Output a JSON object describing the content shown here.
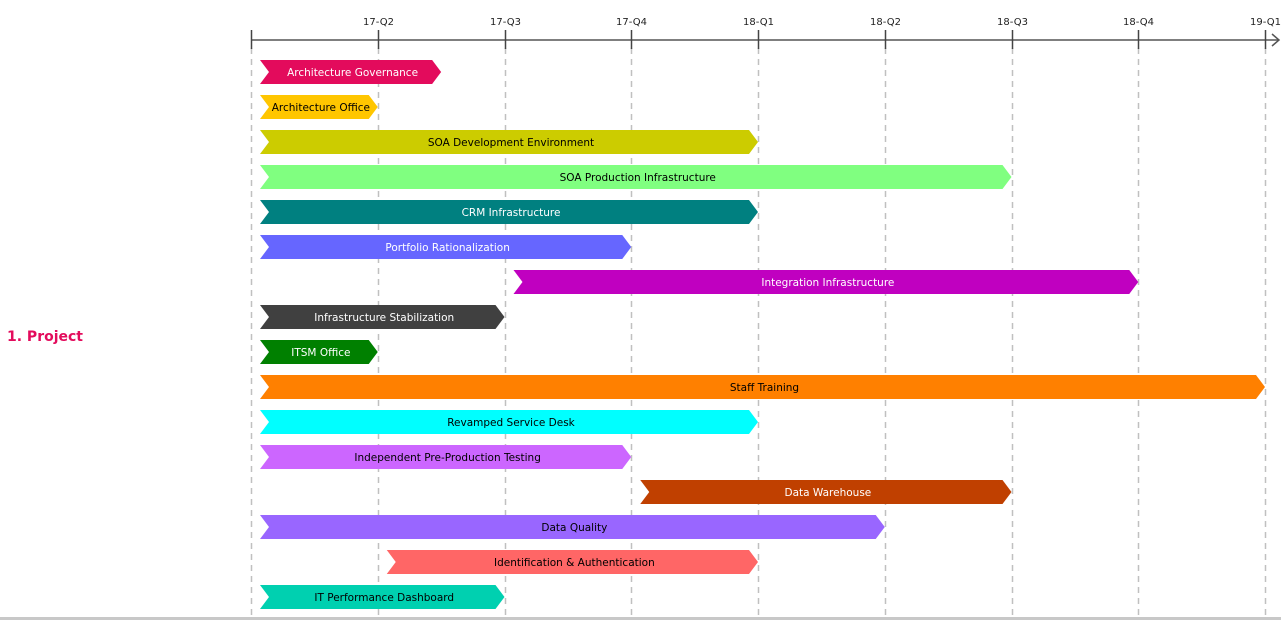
{
  "chart_data": {
    "type": "gantt",
    "title": "",
    "group_label": "1. Project",
    "axis": {
      "start": "17-Q1",
      "ticks": [
        "17-Q2",
        "17-Q3",
        "17-Q4",
        "18-Q1",
        "18-Q2",
        "18-Q3",
        "18-Q4",
        "19-Q1"
      ],
      "range_quarters": [
        0,
        8
      ],
      "grid": "dashed vertical at each quarter"
    },
    "tasks": [
      {
        "name": "Architecture Governance",
        "start": 0,
        "end": 1.5,
        "color": "#e30b5c",
        "text_color": "#ffffff"
      },
      {
        "name": "Architecture Office",
        "start": 0,
        "end": 1,
        "color": "#ffc600",
        "text_color": "#000000"
      },
      {
        "name": "SOA Development Environment",
        "start": 0,
        "end": 4,
        "color": "#cccc00",
        "text_color": "#000000"
      },
      {
        "name": "SOA Production Infrastructure",
        "start": 0,
        "end": 6,
        "color": "#80ff80",
        "text_color": "#000000"
      },
      {
        "name": "CRM Infrastructure",
        "start": 0,
        "end": 4,
        "color": "#008080",
        "text_color": "#ffffff"
      },
      {
        "name": "Portfolio Rationalization",
        "start": 0,
        "end": 3,
        "color": "#6666ff",
        "text_color": "#ffffff"
      },
      {
        "name": "Integration Infrastructure",
        "start": 2,
        "end": 7,
        "color": "#c000c0",
        "text_color": "#ffffff"
      },
      {
        "name": "Infrastructure Stabilization",
        "start": 0,
        "end": 2,
        "color": "#404040",
        "text_color": "#ffffff"
      },
      {
        "name": "ITSM Office",
        "start": 0,
        "end": 1,
        "color": "#008000",
        "text_color": "#ffffff"
      },
      {
        "name": "Staff Training",
        "start": 0,
        "end": 8,
        "color": "#ff8000",
        "text_color": "#000000"
      },
      {
        "name": "Revamped Service Desk",
        "start": 0,
        "end": 4,
        "color": "#00ffff",
        "text_color": "#000000"
      },
      {
        "name": "Independent Pre-Production Testing",
        "start": 0,
        "end": 3,
        "color": "#cc66ff",
        "text_color": "#000000"
      },
      {
        "name": "Data Warehouse",
        "start": 3,
        "end": 6,
        "color": "#c04000",
        "text_color": "#ffffff"
      },
      {
        "name": "Data Quality",
        "start": 0,
        "end": 5,
        "color": "#9966ff",
        "text_color": "#000000"
      },
      {
        "name": "Identification & Authentication",
        "start": 1,
        "end": 4,
        "color": "#ff6666",
        "text_color": "#000000"
      },
      {
        "name": "IT Performance Dashboard",
        "start": 0,
        "end": 2,
        "color": "#00d0b0",
        "text_color": "#000000"
      }
    ]
  }
}
